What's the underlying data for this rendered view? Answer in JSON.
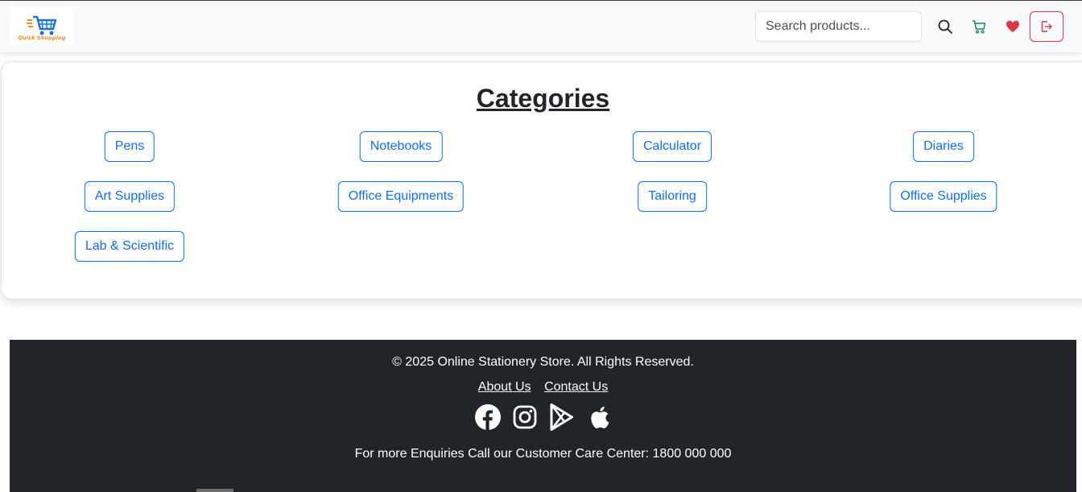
{
  "navbar": {
    "logo_text": "Quick Shopping",
    "search_placeholder": "Search products...",
    "icons": [
      "search-icon",
      "cart-icon",
      "heart-icon",
      "logout-icon"
    ],
    "colors": {
      "cart": "#198754",
      "heart": "#dc3545",
      "logout": "#dc3545"
    }
  },
  "categories": {
    "title": "Categories",
    "items": [
      "Pens",
      "Notebooks",
      "Calculator",
      "Diaries",
      "Art Supplies",
      "Office Equipments",
      "Tailoring",
      "Office Supplies",
      "Lab & Scientific"
    ],
    "accent": "#0d6efd"
  },
  "footer": {
    "copyright": "© 2025 Online Stationery Store. All Rights Reserved.",
    "links": [
      "About Us",
      "Contact Us"
    ],
    "social_icons": [
      "facebook-icon",
      "instagram-icon",
      "google-play-icon",
      "apple-icon"
    ],
    "enquiry": "For more Enquiries Call our Customer Care Center: 1800 000 000",
    "background": "#212529"
  }
}
